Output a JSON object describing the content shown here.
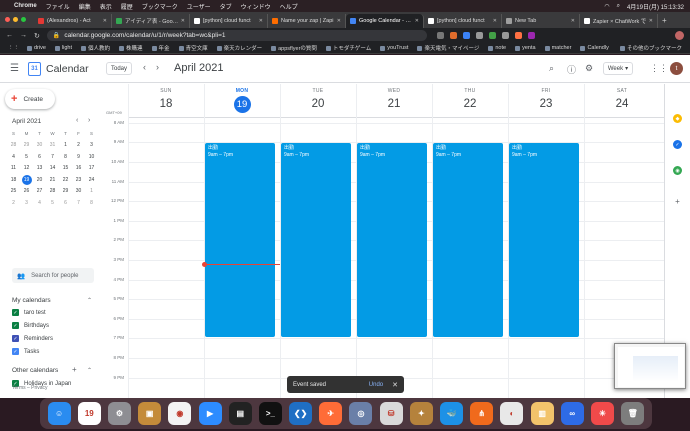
{
  "menubar": {
    "app": "Chrome",
    "items": [
      "ファイル",
      "編集",
      "表示",
      "履歴",
      "ブックマーク",
      "ユーザー",
      "タブ",
      "ウィンドウ",
      "ヘルプ"
    ],
    "clock": "4月19日(月)  15:13:32"
  },
  "tabs": [
    {
      "label": "(Alexandros) - Act",
      "color": "#e53935"
    },
    {
      "label": "アイディア表 - Google",
      "color": "#34a853"
    },
    {
      "label": "[python] cloud funct",
      "color": "#ffffff"
    },
    {
      "label": "Name your zap | Zapi",
      "color": "#ff6d00"
    },
    {
      "label": "Google Calendar - We",
      "color": "#4285f4",
      "active": true
    },
    {
      "label": "[python] cloud funct",
      "color": "#ffffff"
    },
    {
      "label": "New Tab",
      "color": "#9e9e9e"
    },
    {
      "label": "Zapier × ChatWork で",
      "color": "#ffffff"
    }
  ],
  "address": {
    "url": "calendar.google.com/calendar/u/1/r/week?tab=wc&pli=1"
  },
  "bookmarks": [
    "drive",
    "light",
    "個人教約",
    "株購連",
    "年金",
    "青空文庫",
    "楽天カレンダー",
    "appsflyerの質問",
    "トモダチゲーム",
    "youTrust",
    "楽天電気・マイページ",
    "note",
    "yenta",
    "matcher",
    "Calendly"
  ],
  "bookmarks_other": "その他のブックマーク",
  "header": {
    "app_title": "Calendar",
    "logo_day": "31",
    "today_label": "Today",
    "range_title": "April 2021",
    "view_label": "Week",
    "user_initial": "t"
  },
  "sidebar": {
    "create_label": "Create",
    "mini_title": "April 2021",
    "weekday_heads": [
      "S",
      "M",
      "T",
      "W",
      "T",
      "F",
      "S"
    ],
    "days": [
      {
        "d": "28",
        "m": true
      },
      {
        "d": "29",
        "m": true
      },
      {
        "d": "30",
        "m": true
      },
      {
        "d": "31",
        "m": true
      },
      {
        "d": "1"
      },
      {
        "d": "2"
      },
      {
        "d": "3"
      },
      {
        "d": "4"
      },
      {
        "d": "5"
      },
      {
        "d": "6"
      },
      {
        "d": "7"
      },
      {
        "d": "8"
      },
      {
        "d": "9"
      },
      {
        "d": "10"
      },
      {
        "d": "11"
      },
      {
        "d": "12"
      },
      {
        "d": "13"
      },
      {
        "d": "14"
      },
      {
        "d": "15"
      },
      {
        "d": "16"
      },
      {
        "d": "17"
      },
      {
        "d": "18"
      },
      {
        "d": "19",
        "today": true
      },
      {
        "d": "20"
      },
      {
        "d": "21"
      },
      {
        "d": "22"
      },
      {
        "d": "23"
      },
      {
        "d": "24"
      },
      {
        "d": "25"
      },
      {
        "d": "26"
      },
      {
        "d": "27"
      },
      {
        "d": "28"
      },
      {
        "d": "29"
      },
      {
        "d": "30"
      },
      {
        "d": "1",
        "m": true
      },
      {
        "d": "2",
        "m": true
      },
      {
        "d": "3",
        "m": true
      },
      {
        "d": "4",
        "m": true
      },
      {
        "d": "5",
        "m": true
      },
      {
        "d": "6",
        "m": true
      },
      {
        "d": "7",
        "m": true
      },
      {
        "d": "8",
        "m": true
      }
    ],
    "search_placeholder": "Search for people",
    "my_calendars_title": "My calendars",
    "my_calendars": [
      {
        "label": "taro test",
        "color": "#0b8043"
      },
      {
        "label": "Birthdays",
        "color": "#0b8043"
      },
      {
        "label": "Reminders",
        "color": "#3f51b5"
      },
      {
        "label": "Tasks",
        "color": "#4285f4"
      }
    ],
    "other_calendars_title": "Other calendars",
    "other_calendars": [
      {
        "label": "Holidays in Japan",
        "color": "#0b8043"
      }
    ],
    "footer": "Terms – Privacy"
  },
  "week": {
    "timezone": "GMT+09",
    "days": [
      {
        "dow": "SUN",
        "num": "18"
      },
      {
        "dow": "MON",
        "num": "19",
        "current": true
      },
      {
        "dow": "TUE",
        "num": "20"
      },
      {
        "dow": "WED",
        "num": "21"
      },
      {
        "dow": "THU",
        "num": "22"
      },
      {
        "dow": "FRI",
        "num": "23"
      },
      {
        "dow": "SAT",
        "num": "24"
      }
    ],
    "hours": [
      "8 AM",
      "9 AM",
      "10 AM",
      "11 AM",
      "12 PM",
      "1 PM",
      "2 PM",
      "3 PM",
      "4 PM",
      "5 PM",
      "6 PM",
      "7 PM",
      "8 PM",
      "9 PM"
    ],
    "events": [
      {
        "day": 1,
        "title": "出勤",
        "time": "9am – 7pm",
        "start": 9,
        "end": 19
      },
      {
        "day": 2,
        "title": "出勤",
        "time": "9am – 7pm",
        "start": 9,
        "end": 19
      },
      {
        "day": 3,
        "title": "出勤",
        "time": "9am – 7pm",
        "start": 9,
        "end": 19
      },
      {
        "day": 4,
        "title": "出勤",
        "time": "9am – 7pm",
        "start": 9,
        "end": 19
      },
      {
        "day": 5,
        "title": "出勤",
        "time": "9am – 7pm",
        "start": 9,
        "end": 19
      }
    ],
    "now_hour": 15.2
  },
  "snackbar": {
    "message": "Event saved",
    "undo_label": "Undo"
  },
  "dock": [
    {
      "name": "finder",
      "color": "#2a8cf0",
      "glyph": "☺"
    },
    {
      "name": "calendar",
      "color": "#ffffff",
      "glyph": "19"
    },
    {
      "name": "settings",
      "color": "#8e8e93",
      "glyph": "⚙"
    },
    {
      "name": "app",
      "color": "#c48b3a",
      "glyph": "▣"
    },
    {
      "name": "chrome",
      "color": "#f3f3f3",
      "glyph": "◉"
    },
    {
      "name": "zoom",
      "color": "#2d8cff",
      "glyph": "▶"
    },
    {
      "name": "activity-monitor",
      "color": "#222222",
      "glyph": "▤"
    },
    {
      "name": "terminal",
      "color": "#111111",
      "glyph": ">_"
    },
    {
      "name": "vscode",
      "color": "#1f6fc4",
      "glyph": "❮❯"
    },
    {
      "name": "postman",
      "color": "#ff6c37",
      "glyph": "✈"
    },
    {
      "name": "sequel",
      "color": "#6a7fa8",
      "glyph": "◎"
    },
    {
      "name": "db",
      "color": "#d9d9d9",
      "glyph": "⛁"
    },
    {
      "name": "app2",
      "color": "#b5823c",
      "glyph": "✦"
    },
    {
      "name": "docker",
      "color": "#1d91e6",
      "glyph": "🐳"
    },
    {
      "name": "sourcetree",
      "color": "#f06a1c",
      "glyph": "⋔"
    },
    {
      "name": "app3",
      "color": "#e8e8e8",
      "glyph": "◐"
    },
    {
      "name": "preview",
      "color": "#f2c36b",
      "glyph": "▥"
    },
    {
      "name": "infinity",
      "color": "#2e6be6",
      "glyph": "∞"
    },
    {
      "name": "app4",
      "color": "#f04a4a",
      "glyph": "✳"
    },
    {
      "name": "trash",
      "color": "#7d7d7d",
      "glyph": "🗑"
    }
  ]
}
